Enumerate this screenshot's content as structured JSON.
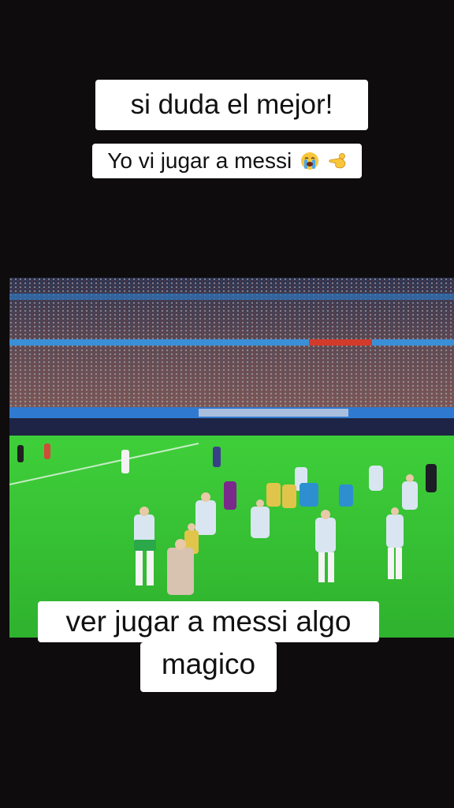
{
  "captions": {
    "top": "si duda el mejor!",
    "second": "Yo vi jugar a messi",
    "bottom_line1": "ver jugar a messi algo",
    "bottom_line2": "magico"
  },
  "icons": [
    "crying-face-emoji",
    "pointing-hand-emoji"
  ],
  "colors": {
    "background": "#0e0c0d",
    "pitch": "#38c335",
    "caption_bg": "#ffffff",
    "caption_text": "#111111"
  }
}
